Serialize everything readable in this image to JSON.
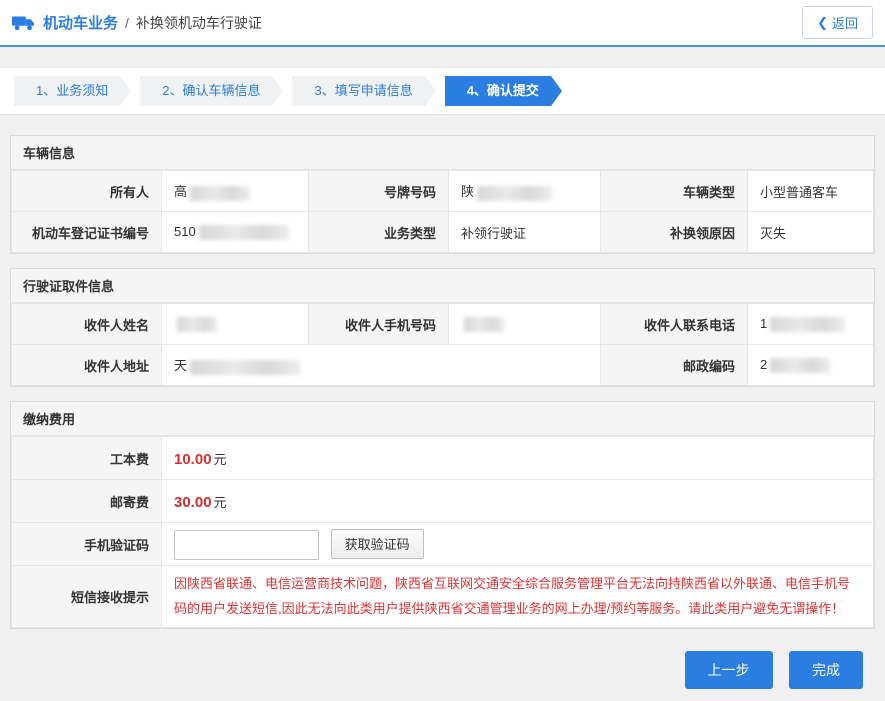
{
  "header": {
    "section_title": "机动车业务",
    "divider": "/",
    "page_title": "补换领机动车行驶证",
    "back_label": "返回"
  },
  "steps": [
    {
      "label": "1、业务须知"
    },
    {
      "label": "2、确认车辆信息"
    },
    {
      "label": "3、填写申请信息"
    },
    {
      "label": "4、确认提交"
    }
  ],
  "vehicle_info": {
    "title": "车辆信息",
    "owner_label": "所有人",
    "owner_value": "高",
    "plate_label": "号牌号码",
    "plate_value": "陕",
    "vehicle_type_label": "车辆类型",
    "vehicle_type_value": "小型普通客车",
    "cert_no_label": "机动车登记证书编号",
    "cert_no_value": "510",
    "business_type_label": "业务类型",
    "business_type_value": "补领行驶证",
    "reason_label": "补换领原因",
    "reason_value": "灭失"
  },
  "pickup_info": {
    "title": "行驶证取件信息",
    "recipient_name_label": "收件人姓名",
    "recipient_name_value": "",
    "recipient_mobile_label": "收件人手机号码",
    "recipient_mobile_value": "",
    "recipient_phone_label": "收件人联系电话",
    "recipient_phone_value": "1",
    "recipient_address_label": "收件人地址",
    "recipient_address_value": "天",
    "postcode_label": "邮政编码",
    "postcode_value": "2"
  },
  "payment": {
    "title": "缴纳费用",
    "production_fee_label": "工本费",
    "production_fee_value": "10.00",
    "postage_fee_label": "邮寄费",
    "postage_fee_value": "30.00",
    "fee_unit": "元",
    "sms_code_label": "手机验证码",
    "sms_code_value": "",
    "get_code_button": "获取验证码",
    "sms_notice_label": "短信接收提示",
    "sms_notice_text": "因陕西省联通、电信运营商技术问题，陕西省互联网交通安全综合服务管理平台无法向持陕西省以外联通、电信手机号码的用户发送短信,因此无法向此类用户提供陕西省交通管理业务的网上办理/预约等服务。请此类用户避免无谓操作！"
  },
  "footer": {
    "prev_button": "上一步",
    "finish_button": "完成"
  },
  "colors": {
    "accent_blue": "#2a7de1",
    "alert_red": "#dd3333"
  }
}
